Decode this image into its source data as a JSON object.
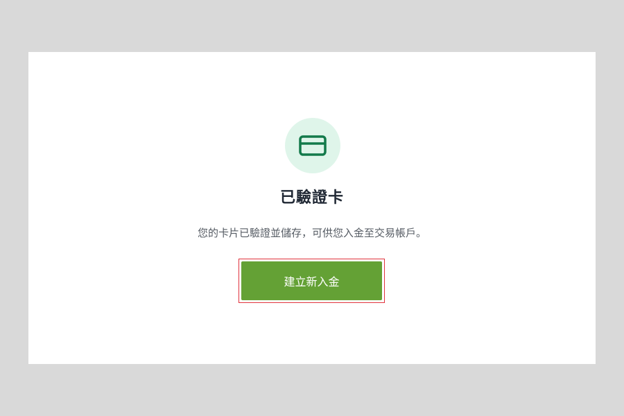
{
  "card": {
    "icon": "credit-card-icon",
    "title": "已驗證卡",
    "description": "您的卡片已驗證並儲存，可供您入金至交易帳戶。",
    "button_label": "建立新入金"
  },
  "colors": {
    "background": "#d9d9d9",
    "panel": "#ffffff",
    "icon_circle": "#dff5ea",
    "icon_stroke": "#137a4b",
    "button": "#64a135",
    "highlight_border": "#e0323c"
  }
}
